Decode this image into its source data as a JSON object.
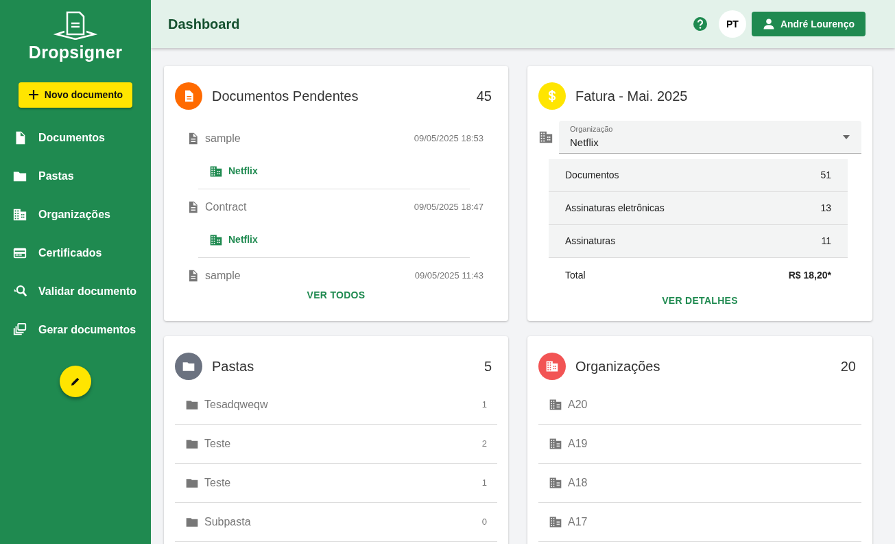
{
  "sidebar": {
    "brand": "Dropsigner",
    "new_button": "Novo documento",
    "items": [
      {
        "label": "Documentos",
        "selected": false
      },
      {
        "label": "Pastas",
        "selected": false
      },
      {
        "label": "Organizações",
        "selected": false
      },
      {
        "label": "Certificados",
        "selected": false
      },
      {
        "label": "Validar documento",
        "selected": false
      },
      {
        "label": "Gerar documentos",
        "selected": false
      }
    ]
  },
  "header": {
    "title": "Dashboard",
    "language": "PT",
    "user": "André Lourenço"
  },
  "pending": {
    "title": "Documentos Pendentes",
    "count": "45",
    "action": "VER TODOS",
    "items": [
      {
        "name": "sample",
        "date": "09/05/2025 18:53",
        "organization": "Netflix"
      },
      {
        "name": "Contract",
        "date": "09/05/2025 18:47",
        "organization": "Netflix"
      },
      {
        "name": "sample",
        "date": "09/05/2025 11:43"
      }
    ]
  },
  "invoice": {
    "title": "Fatura - Mai. 2025",
    "select_label": "Organização",
    "select_value": "Netflix",
    "rows": [
      {
        "label": "Documentos",
        "value": "51"
      },
      {
        "label": "Assinaturas eletrônicas",
        "value": "13"
      },
      {
        "label": "Assinaturas",
        "value": "11"
      }
    ],
    "total_label": "Total",
    "total_value": "R$ 18,20*",
    "action": "VER DETALHES"
  },
  "folders": {
    "title": "Pastas",
    "count": "5",
    "items": [
      {
        "name": "Tesadqweqw",
        "count": "1"
      },
      {
        "name": "Teste",
        "count": "2"
      },
      {
        "name": "Teste",
        "count": "1"
      },
      {
        "name": "Subpasta",
        "count": "0"
      }
    ]
  },
  "organizations": {
    "title": "Organizações",
    "count": "20",
    "items": [
      {
        "name": "A20"
      },
      {
        "name": "A19"
      },
      {
        "name": "A18"
      },
      {
        "name": "A17"
      }
    ]
  }
}
